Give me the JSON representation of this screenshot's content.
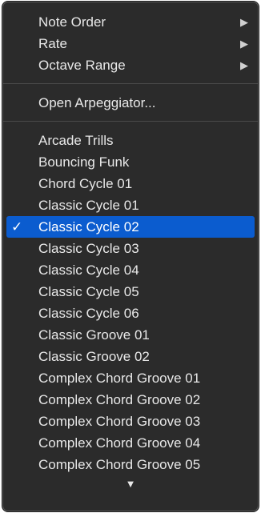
{
  "submenus": [
    {
      "label": "Note Order",
      "arrow": "▶"
    },
    {
      "label": "Rate",
      "arrow": "▶"
    },
    {
      "label": "Octave Range",
      "arrow": "▶"
    }
  ],
  "open_label": "Open Arpeggiator...",
  "presets": {
    "checkmark": "✓",
    "selected": "Classic Cycle 02",
    "items": [
      "Arcade Trills",
      "Bouncing Funk",
      "Chord Cycle 01",
      "Classic Cycle 01",
      "Classic Cycle 02",
      "Classic Cycle 03",
      "Classic Cycle 04",
      "Classic Cycle 05",
      "Classic Cycle 06",
      "Classic Groove 01",
      "Classic Groove 02",
      "Complex Chord Groove 01",
      "Complex Chord Groove 02",
      "Complex Chord Groove 03",
      "Complex Chord Groove 04",
      "Complex Chord Groove 05"
    ]
  },
  "scroll_more_glyph": "▼",
  "colors": {
    "menu_background": "#2b2b2b",
    "highlight": "#0b5ccf",
    "text": "#e8e8e8"
  }
}
